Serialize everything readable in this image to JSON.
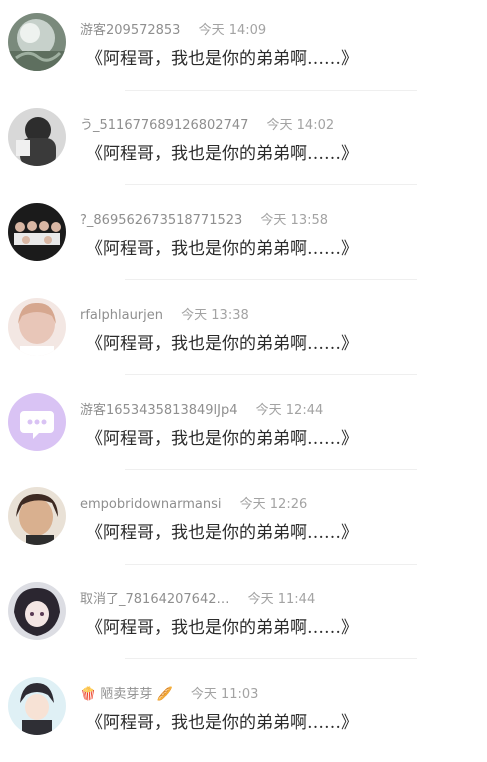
{
  "comments": [
    {
      "user": "游客209572853",
      "time": "今天 14:09",
      "text": "《阿程哥，我也是你的弟弟啊……》"
    },
    {
      "user": "う_511677689126802747",
      "time": "今天 14:02",
      "text": "《阿程哥，我也是你的弟弟啊……》"
    },
    {
      "user": "?_869562673518771523",
      "time": "今天 13:58",
      "text": "《阿程哥，我也是你的弟弟啊……》"
    },
    {
      "user": "rfalphlaurjen",
      "time": "今天 13:38",
      "text": "《阿程哥，我也是你的弟弟啊……》"
    },
    {
      "user": "游客1653435813849lJp4",
      "time": "今天 12:44",
      "text": "《阿程哥，我也是你的弟弟啊……》"
    },
    {
      "user": "empobridownarmansi",
      "time": "今天 12:26",
      "text": "《阿程哥，我也是你的弟弟啊……》"
    },
    {
      "user": "取消了_78164207642…",
      "time": "今天 11:44",
      "text": "《阿程哥，我也是你的弟弟啊……》"
    },
    {
      "user": "陋卖芽芽",
      "time": "今天 11:03",
      "text": "《阿程哥，我也是你的弟弟啊……》",
      "prefix_emoji": "🍿",
      "suffix_emoji": "🥖"
    }
  ],
  "colors": {
    "meta_text": "#9a9a9a",
    "comment_text": "#2b2b2b",
    "divider": "#efefef",
    "chat_avatar_bg": "#d9c3f4"
  },
  "avatars": [
    "photo-avatar-landscape",
    "photo-avatar-person-dark",
    "photo-avatar-group",
    "photo-avatar-girl",
    "chat-bubble-icon",
    "photo-avatar-face",
    "photo-avatar-anime",
    "photo-avatar-cartoon"
  ]
}
